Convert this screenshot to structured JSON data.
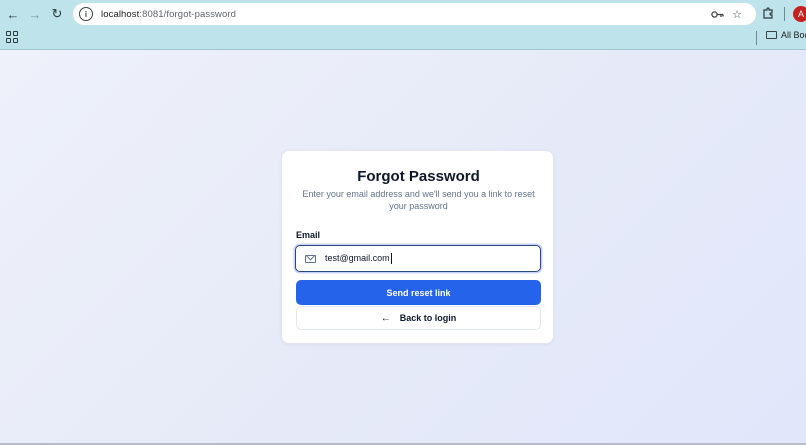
{
  "browser": {
    "url_host": "localhost",
    "url_rest": ":8081/forgot-password",
    "avatar_letter": "A",
    "bookmarks_label": "All Book"
  },
  "icons": {
    "back": "arrow-left-icon",
    "forward": "arrow-right-icon",
    "reload": "reload-icon",
    "site_info": "site-info-icon",
    "password": "key-icon",
    "bookmark": "star-icon",
    "extensions": "puzzle-icon",
    "apps": "apps-grid-icon",
    "folder": "folder-icon",
    "mail": "mail-icon",
    "back_arrow": "arrow-left-icon"
  },
  "form": {
    "title": "Forgot Password",
    "subtitle": "Enter your email address and we'll send you a link to reset your password",
    "email_label": "Email",
    "email_value": "test@gmail.com",
    "send_button": "Send reset link",
    "back_button": "Back to login"
  },
  "colors": {
    "primary": "#2563eb",
    "browser_chrome": "#bfe3ea",
    "page_background": "#e9ecf7",
    "avatar": "#c5221f"
  }
}
